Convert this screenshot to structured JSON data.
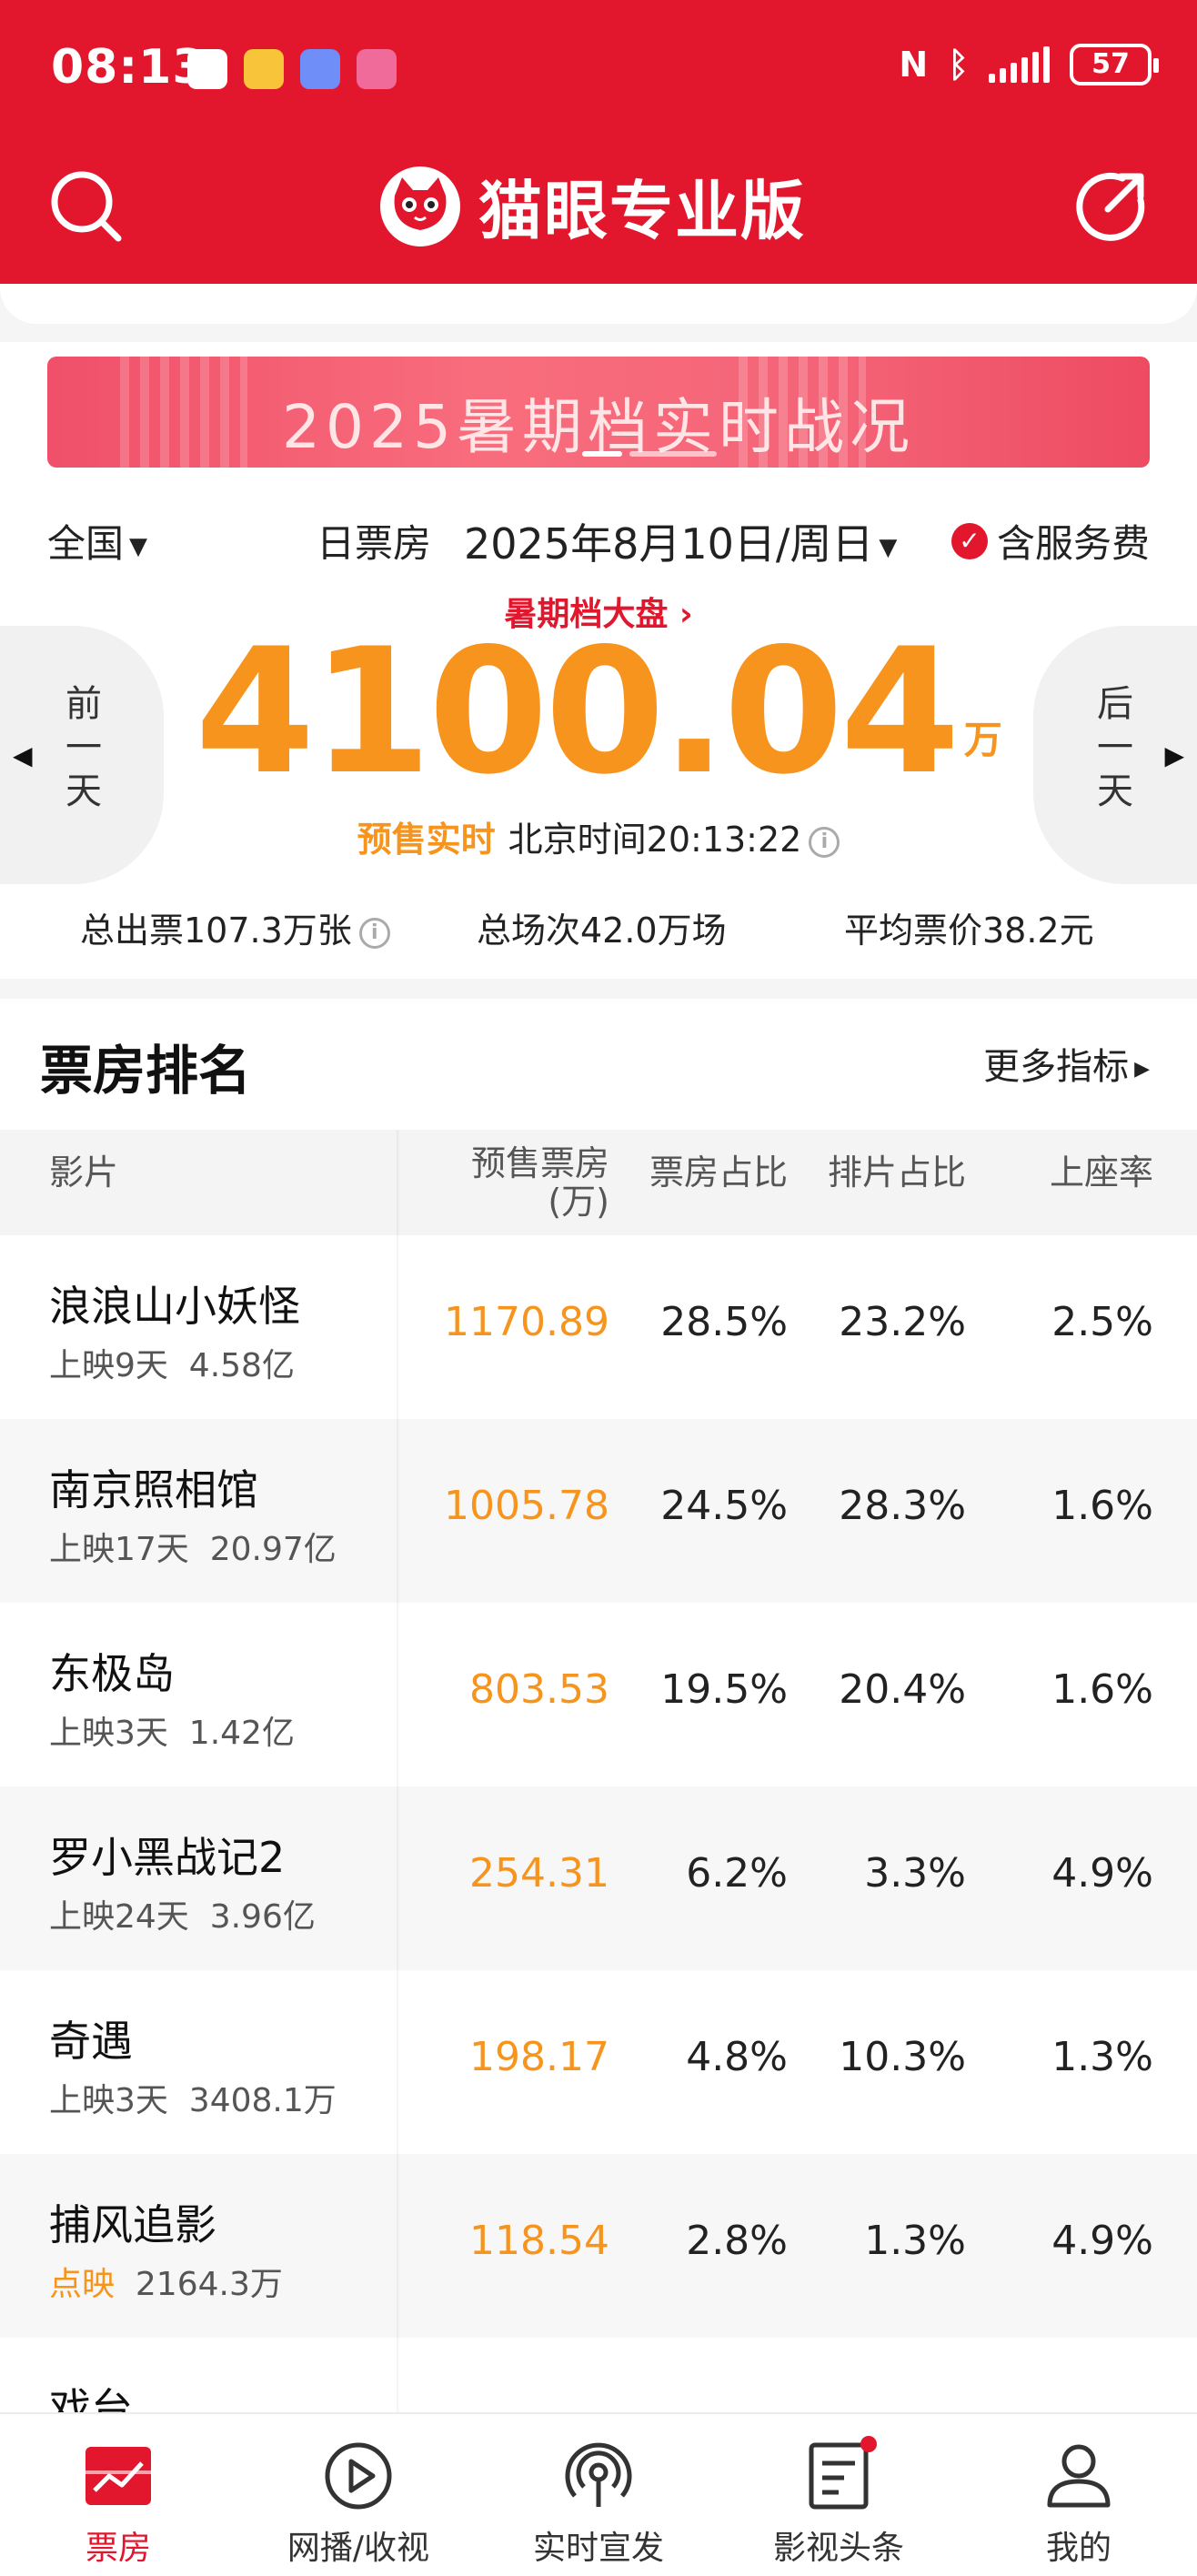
{
  "status_bar": {
    "time": "08:13",
    "battery": "57",
    "app_icon_colors": [
      "#ffffff",
      "#f8c43a",
      "#6f8ef8",
      "#f06a9a"
    ]
  },
  "header": {
    "app_title": "猫眼专业版",
    "search_icon": "search-icon",
    "share_icon": "share-icon",
    "brand_color": "#e2162c"
  },
  "banner": {
    "text": "2025暑期档实时战况"
  },
  "filters": {
    "region": "全国",
    "type_label": "日票房",
    "date": "2025年8月10日/周日",
    "service_fee": "含服务费"
  },
  "summary": {
    "summer_link": "暑期档大盘 ›",
    "total_box_office": "4100.04",
    "unit": "万",
    "presale_tag": "预售实时",
    "beijing_time": "北京时间20:13:22",
    "prev_day": "前一天",
    "next_day": "后一天",
    "tickets": "总出票107.3万张",
    "screenings": "总场次42.0万场",
    "avg_price": "平均票价38.2元",
    "accent_color": "#f7941d"
  },
  "ranking": {
    "title": "票房排名",
    "more": "更多指标",
    "columns": {
      "film": "影片",
      "presale": "预售票房",
      "presale_unit": "(万)",
      "box_share": "票房占比",
      "show_share": "排片占比",
      "occupancy": "上座率"
    },
    "rows": [
      {
        "name": "浪浪山小妖怪",
        "days": "上映9天",
        "total": "4.58亿",
        "presale": "1170.89",
        "box_share": "28.5%",
        "show_share": "23.2%",
        "occupancy": "2.5%"
      },
      {
        "name": "南京照相馆",
        "days": "上映17天",
        "total": "20.97亿",
        "presale": "1005.78",
        "box_share": "24.5%",
        "show_share": "28.3%",
        "occupancy": "1.6%"
      },
      {
        "name": "东极岛",
        "days": "上映3天",
        "total": "1.42亿",
        "presale": "803.53",
        "box_share": "19.5%",
        "show_share": "20.4%",
        "occupancy": "1.6%"
      },
      {
        "name": "罗小黑战记2",
        "days": "上映24天",
        "total": "3.96亿",
        "presale": "254.31",
        "box_share": "6.2%",
        "show_share": "3.3%",
        "occupancy": "4.9%"
      },
      {
        "name": "奇遇",
        "days": "上映3天",
        "total": "3408.1万",
        "presale": "198.17",
        "box_share": "4.8%",
        "show_share": "10.3%",
        "occupancy": "1.3%"
      },
      {
        "name": "捕风追影",
        "days": "点映",
        "total": "2164.3万",
        "presale": "118.54",
        "box_share": "2.8%",
        "show_share": "1.3%",
        "occupancy": "4.9%"
      },
      {
        "name": "戏台",
        "days": "",
        "total": "",
        "presale": "",
        "box_share": "",
        "show_share": "",
        "occupancy": ""
      }
    ]
  },
  "bottom_nav": [
    {
      "label": "票房",
      "icon": "box-office-chart-icon"
    },
    {
      "label": "网播/收视",
      "icon": "play-icon"
    },
    {
      "label": "实时宣发",
      "icon": "broadcast-icon"
    },
    {
      "label": "影视头条",
      "icon": "news-icon"
    },
    {
      "label": "我的",
      "icon": "profile-icon"
    }
  ]
}
